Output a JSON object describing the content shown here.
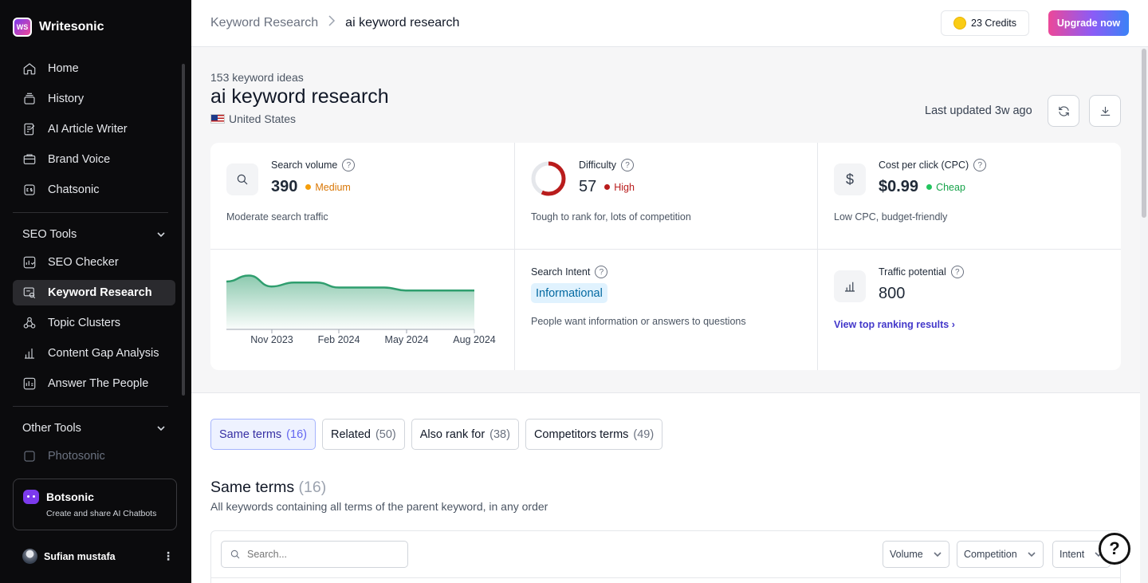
{
  "app": {
    "name": "Writesonic",
    "logo_text": "WS"
  },
  "sidebar": {
    "items": [
      {
        "label": "Home",
        "icon": "home-icon"
      },
      {
        "label": "History",
        "icon": "history-icon"
      },
      {
        "label": "AI Article Writer",
        "icon": "article-icon"
      },
      {
        "label": "Brand Voice",
        "icon": "brand-voice-icon"
      },
      {
        "label": "Chatsonic",
        "icon": "chatsonic-icon"
      }
    ],
    "seo_section": "SEO Tools",
    "seo_items": [
      {
        "label": "SEO Checker",
        "icon": "seo-checker-icon"
      },
      {
        "label": "Keyword Research",
        "icon": "keyword-research-icon",
        "active": true
      },
      {
        "label": "Topic Clusters",
        "icon": "topic-clusters-icon"
      },
      {
        "label": "Content Gap Analysis",
        "icon": "bar-chart-icon"
      },
      {
        "label": "Answer The People",
        "icon": "answer-people-icon"
      }
    ],
    "other_section": "Other Tools",
    "other_items": [
      {
        "label": "Photosonic",
        "icon": "photosonic-icon"
      }
    ],
    "botsonic": {
      "title": "Botsonic",
      "subtitle": "Create and share AI Chatbots"
    },
    "user": {
      "name": "Sufian mustafa"
    }
  },
  "topbar": {
    "breadcrumb_root": "Keyword Research",
    "breadcrumb_current": "ai keyword research",
    "credits": "23 Credits",
    "upgrade": "Upgrade now"
  },
  "keyword": {
    "ideas_count": "153 keyword ideas",
    "title": "ai keyword research",
    "country": "United States",
    "last_updated": "Last updated 3w ago"
  },
  "metrics": {
    "search_volume": {
      "label": "Search volume",
      "value": "390",
      "level": "Medium",
      "desc": "Moderate search traffic",
      "color": "#f59e0b"
    },
    "difficulty": {
      "label": "Difficulty",
      "value": "57",
      "level": "High",
      "desc": "Tough to rank for, lots of competition",
      "color": "#b91c1c",
      "score_fraction": 0.57
    },
    "cpc": {
      "label": "Cost per click (CPC)",
      "value": "$0.99",
      "level": "Cheap",
      "desc": "Low CPC, budget-friendly",
      "color": "#16a34a"
    },
    "intent": {
      "label": "Search Intent",
      "value": "Informational",
      "desc": "People want information or answers to questions"
    },
    "traffic": {
      "label": "Traffic potential",
      "value": "800",
      "link": "View top ranking results ›"
    }
  },
  "chart_data": {
    "type": "area",
    "x": [
      "Nov 2023",
      "Feb 2024",
      "May 2024",
      "Aug 2024"
    ],
    "tick_labels": [
      "Nov 2023",
      "Feb 2024",
      "May 2024",
      "Aug 2024"
    ],
    "series": [
      {
        "values": [
          480,
          540,
          430,
          470,
          470,
          420,
          420,
          420,
          390,
          390,
          390,
          390
        ]
      }
    ],
    "ylim": [
      0,
      600
    ],
    "color": "#2f9e6e",
    "grid": false
  },
  "tabs": [
    {
      "label": "Same terms",
      "count": "(16)",
      "active": true
    },
    {
      "label": "Related",
      "count": "(50)"
    },
    {
      "label": "Also rank for",
      "count": "(38)"
    },
    {
      "label": "Competitors terms",
      "count": "(49)"
    }
  ],
  "section": {
    "title": "Same terms",
    "count": "(16)",
    "subtitle": "All keywords containing all terms of the parent keyword, in any order"
  },
  "table": {
    "search_placeholder": "Search...",
    "filters": [
      "Volume",
      "Competition",
      "Intent"
    ]
  }
}
